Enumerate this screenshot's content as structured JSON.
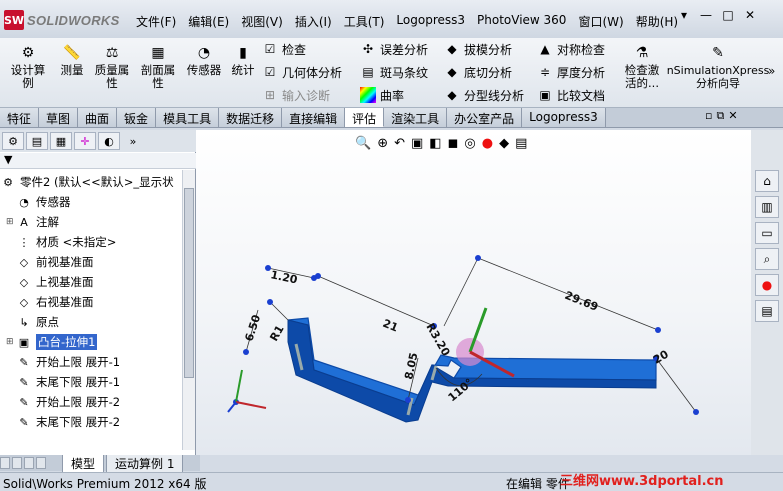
{
  "app": {
    "brand": "SOLIDWORKS",
    "brand_icon_text": "SW"
  },
  "menu": [
    "文件(F)",
    "编辑(E)",
    "视图(V)",
    "插入(I)",
    "工具(T)",
    "Logopress3",
    "PhotoView 360",
    "窗口(W)",
    "帮助(H)"
  ],
  "window_buttons": [
    "▾",
    "—",
    "□",
    "✕"
  ],
  "ribbon": {
    "big": [
      {
        "label": "设计算\n例",
        "icon": "design-study-icon"
      },
      {
        "label": "测量",
        "icon": "measure-icon"
      },
      {
        "label": "质量属\n性",
        "icon": "mass-properties-icon"
      },
      {
        "label": "剖面属\n性",
        "icon": "section-properties-icon"
      },
      {
        "label": "传感器",
        "icon": "sensor-icon"
      },
      {
        "label": "统计",
        "icon": "statistics-icon"
      }
    ],
    "col1": [
      "检查",
      "几何体分析",
      "输入诊断"
    ],
    "col2": [
      "误差分析",
      "斑马条纹",
      "曲率"
    ],
    "col3": [
      "拔模分析",
      "底切分析",
      "分型线分析"
    ],
    "col4": [
      "对称检查",
      "厚度分析",
      "比较文档"
    ],
    "check_active": "检查激\n活的...",
    "xpress": "nSimulationXpress\n分析向导"
  },
  "tabs": [
    "特征",
    "草图",
    "曲面",
    "钣金",
    "模具工具",
    "数据迁移",
    "直接编辑",
    "评估",
    "渲染工具",
    "办公室产品",
    "Logopress3"
  ],
  "active_tab": "评估",
  "tree": {
    "root": "零件2 (默认<<默认>_显示状",
    "items": [
      {
        "label": "传感器",
        "icon": "sensor-icon",
        "expand": false
      },
      {
        "label": "注解",
        "icon": "annotation-icon",
        "expand": true
      },
      {
        "label": "材质 <未指定>",
        "icon": "material-icon",
        "expand": false
      },
      {
        "label": "前视基准面",
        "icon": "plane-icon",
        "expand": false
      },
      {
        "label": "上视基准面",
        "icon": "plane-icon",
        "expand": false
      },
      {
        "label": "右视基准面",
        "icon": "plane-icon",
        "expand": false
      },
      {
        "label": "原点",
        "icon": "origin-icon",
        "expand": false
      },
      {
        "label": "凸台-拉伸1",
        "icon": "extrude-icon",
        "expand": true,
        "selected": true
      },
      {
        "label": "开始上限 展开-1",
        "icon": "sheetmetal-icon",
        "expand": false
      },
      {
        "label": "末尾下限 展开-1",
        "icon": "sheetmetal-icon",
        "expand": false
      },
      {
        "label": "开始上限 展开-2",
        "icon": "sheetmetal-icon",
        "expand": false
      },
      {
        "label": "末尾下限 展开-2",
        "icon": "sheetmetal-icon",
        "expand": false
      }
    ]
  },
  "bottom_tabs": [
    "模型",
    "运动算例 1"
  ],
  "status": {
    "left": "Solid\\Works Premium 2012 x64 版",
    "right": "在编辑 零件"
  },
  "watermark": "三维网www.3dportal.cn",
  "dimensions": [
    "1.20",
    "21",
    "29.69",
    "6.50",
    "R1",
    "8.05",
    "R3.20",
    "110°",
    "20"
  ],
  "colors": {
    "part_blue": "#1f6fd6",
    "part_dark": "#0d4aa8",
    "dim_line": "#333333",
    "accent_red": "#c8102e"
  }
}
